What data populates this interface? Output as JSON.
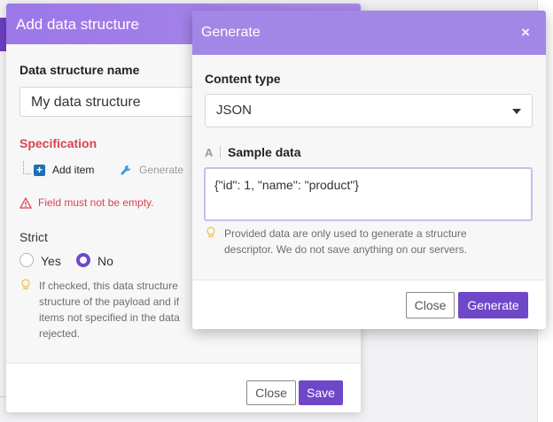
{
  "back_dialog": {
    "title": "Add data structure",
    "name_label": "Data structure name",
    "name_value": "My data structure",
    "spec_label": "Specification",
    "add_item_label": "Add item",
    "generate_link_label": "Generate",
    "error_text": "Field must not be empty.",
    "strict_label": "Strict",
    "radio_yes": "Yes",
    "radio_no": "No",
    "strict_selected": "No",
    "hint_lines": [
      "If checked, this data structure",
      "structure of the payload and if",
      "items not specified in the data",
      "rejected."
    ],
    "close_label": "Close",
    "save_label": "Save"
  },
  "front_dialog": {
    "title": "Generate",
    "close_icon": "close-icon",
    "content_type_label": "Content type",
    "content_type_value": "JSON",
    "sample_label": "Sample data",
    "sample_value": "{\"id\": 1, \"name\": \"product\"}",
    "hint_lines": [
      "Provided data are only used to generate a structure",
      "descriptor. We do not save anything on our servers."
    ],
    "close_label": "Close",
    "generate_label": "Generate"
  },
  "colors": {
    "accent": "#6e48c9",
    "header": "#a387e6",
    "error": "#d9434e"
  }
}
